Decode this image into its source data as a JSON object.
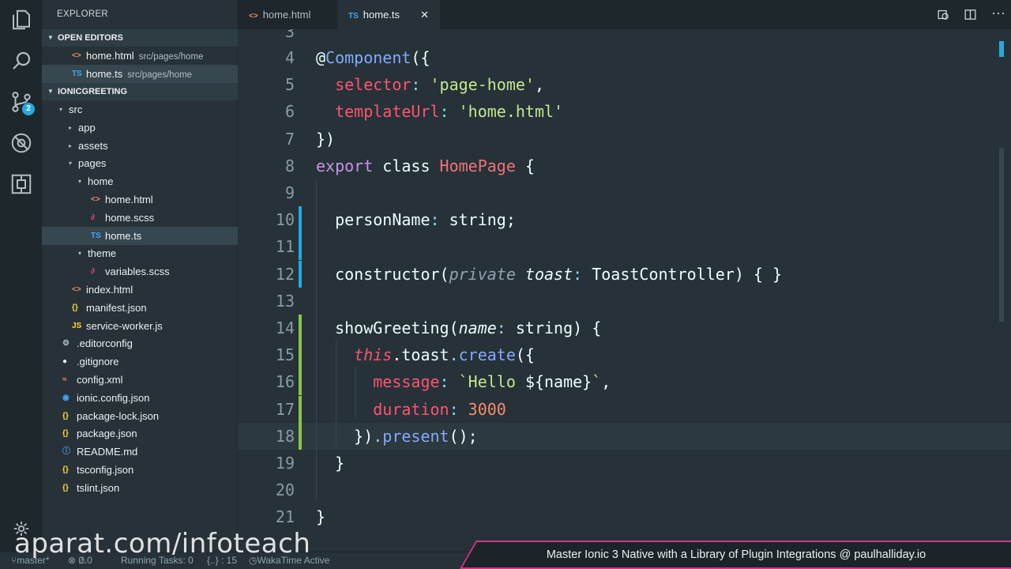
{
  "explorer": {
    "title": "EXPLORER",
    "open_editors_label": "OPEN EDITORS",
    "open_editors": [
      {
        "name": "home.html",
        "path": "src/pages/home",
        "icon": "<>"
      },
      {
        "name": "home.ts",
        "path": "src/pages/home",
        "icon": "TS"
      }
    ],
    "project_label": "IONICGREETING",
    "tree": [
      {
        "name": "src",
        "icon": "",
        "twisty": "▾"
      },
      {
        "name": "app",
        "icon": "",
        "twisty": "▸"
      },
      {
        "name": "assets",
        "icon": "",
        "twisty": "▸"
      },
      {
        "name": "pages",
        "icon": "",
        "twisty": "▾"
      },
      {
        "name": "home",
        "icon": "",
        "twisty": "▾"
      },
      {
        "name": "home.html",
        "icon": "<>",
        "twisty": ""
      },
      {
        "name": "home.scss",
        "icon": "∂",
        "twisty": ""
      },
      {
        "name": "home.ts",
        "icon": "TS",
        "twisty": ""
      },
      {
        "name": "theme",
        "icon": "",
        "twisty": "▾"
      },
      {
        "name": "variables.scss",
        "icon": "∂",
        "twisty": ""
      },
      {
        "name": "index.html",
        "icon": "<>",
        "twisty": ""
      },
      {
        "name": "manifest.json",
        "icon": "{}",
        "twisty": ""
      },
      {
        "name": "service-worker.js",
        "icon": "JS",
        "twisty": ""
      },
      {
        "name": ".editorconfig",
        "icon": "⚙",
        "twisty": ""
      },
      {
        "name": ".gitignore",
        "icon": "●",
        "twisty": ""
      },
      {
        "name": "config.xml",
        "icon": "≈",
        "twisty": ""
      },
      {
        "name": "ionic.config.json",
        "icon": "◉",
        "twisty": ""
      },
      {
        "name": "package-lock.json",
        "icon": "{}",
        "twisty": ""
      },
      {
        "name": "package.json",
        "icon": "{}",
        "twisty": ""
      },
      {
        "name": "README.md",
        "icon": "ⓘ",
        "twisty": ""
      },
      {
        "name": "tsconfig.json",
        "icon": "{}",
        "twisty": ""
      },
      {
        "name": "tslint.json",
        "icon": "{}",
        "twisty": ""
      }
    ]
  },
  "activity": {
    "scm_badge": "2"
  },
  "tabs": [
    {
      "name": "home.html",
      "icon": "<>"
    },
    {
      "name": "home.ts",
      "icon": "TS",
      "close": "✕"
    }
  ],
  "editor": {
    "partial_line_number": "3",
    "lines": [
      {
        "n": "4",
        "tokens": [
          [
            "tk-plain",
            "@"
          ],
          [
            "tk-fn",
            "Component"
          ],
          [
            "tk-plain",
            "({"
          ]
        ]
      },
      {
        "n": "5",
        "tokens": [
          [
            "tk-plain",
            "  "
          ],
          [
            "tk-prop",
            "selector"
          ],
          [
            "tk-punc",
            ":"
          ],
          [
            "tk-plain",
            " "
          ],
          [
            "tk-str",
            "'page-home'"
          ],
          [
            "tk-plain",
            ","
          ]
        ]
      },
      {
        "n": "6",
        "tokens": [
          [
            "tk-plain",
            "  "
          ],
          [
            "tk-prop",
            "templateUrl"
          ],
          [
            "tk-punc",
            ":"
          ],
          [
            "tk-plain",
            " "
          ],
          [
            "tk-str",
            "'home.html'"
          ]
        ]
      },
      {
        "n": "7",
        "tokens": [
          [
            "tk-plain",
            "})"
          ]
        ]
      },
      {
        "n": "8",
        "tokens": [
          [
            "tk-kw",
            "export"
          ],
          [
            "tk-plain",
            " class "
          ],
          [
            "tk-class",
            "HomePage"
          ],
          [
            "tk-plain",
            " {"
          ]
        ]
      },
      {
        "n": "9",
        "tokens": []
      },
      {
        "n": "10",
        "tokens": [
          [
            "tk-plain",
            "  personName"
          ],
          [
            "tk-punc",
            ":"
          ],
          [
            "tk-plain",
            " string;"
          ]
        ]
      },
      {
        "n": "11",
        "tokens": []
      },
      {
        "n": "12",
        "tokens": [
          [
            "tk-plain",
            "  constructor("
          ],
          [
            "tk-dim",
            "private"
          ],
          [
            "tk-plain",
            " "
          ],
          [
            "tk-ital",
            "toast"
          ],
          [
            "tk-punc",
            ":"
          ],
          [
            "tk-plain",
            " ToastController) { }"
          ]
        ]
      },
      {
        "n": "13",
        "tokens": []
      },
      {
        "n": "14",
        "tokens": [
          [
            "tk-plain",
            "  showGreeting("
          ],
          [
            "tk-ital",
            "name"
          ],
          [
            "tk-punc",
            ":"
          ],
          [
            "tk-plain",
            " string) {"
          ]
        ]
      },
      {
        "n": "15",
        "tokens": [
          [
            "tk-plain",
            "    "
          ],
          [
            "tk-this",
            "this"
          ],
          [
            "tk-plain",
            ".toast"
          ],
          [
            "tk-punc",
            "."
          ],
          [
            "tk-fn",
            "create"
          ],
          [
            "tk-plain",
            "({"
          ]
        ]
      },
      {
        "n": "16",
        "tokens": [
          [
            "tk-plain",
            "      "
          ],
          [
            "tk-prop",
            "message"
          ],
          [
            "tk-punc",
            ":"
          ],
          [
            "tk-plain",
            " "
          ],
          [
            "tk-str",
            "`Hello "
          ],
          [
            "tk-plain",
            "${name}"
          ],
          [
            "tk-str",
            "`"
          ],
          [
            "tk-plain",
            ","
          ]
        ]
      },
      {
        "n": "17",
        "tokens": [
          [
            "tk-plain",
            "      "
          ],
          [
            "tk-prop",
            "duration"
          ],
          [
            "tk-punc",
            ":"
          ],
          [
            "tk-plain",
            " "
          ],
          [
            "tk-num",
            "3000"
          ]
        ]
      },
      {
        "n": "18",
        "tokens": [
          [
            "tk-plain",
            "    })"
          ],
          [
            "tk-punc",
            "."
          ],
          [
            "tk-fn",
            "present"
          ],
          [
            "tk-plain",
            "();"
          ]
        ]
      },
      {
        "n": "19",
        "tokens": [
          [
            "tk-plain",
            "  }"
          ]
        ]
      },
      {
        "n": "20",
        "tokens": []
      },
      {
        "n": "21",
        "tokens": [
          [
            "tk-plain",
            "}"
          ]
        ]
      }
    ]
  },
  "status": {
    "branch": "master*",
    "errors": "0",
    "warnings": "0",
    "tasks": "Running Tasks: 0",
    "braces": "{..} : 15",
    "wakatime": "WakaTime Active"
  },
  "watermark": "aparat.com/infoteach",
  "banner": "Master Ionic 3 Native with a Library of Plugin Integrations @ paulhalliday.io",
  "colors": {
    "accent": "#26a9e0",
    "banner_border": "#d63384",
    "modified": "#26a9e0",
    "added": "#8bc34a"
  }
}
